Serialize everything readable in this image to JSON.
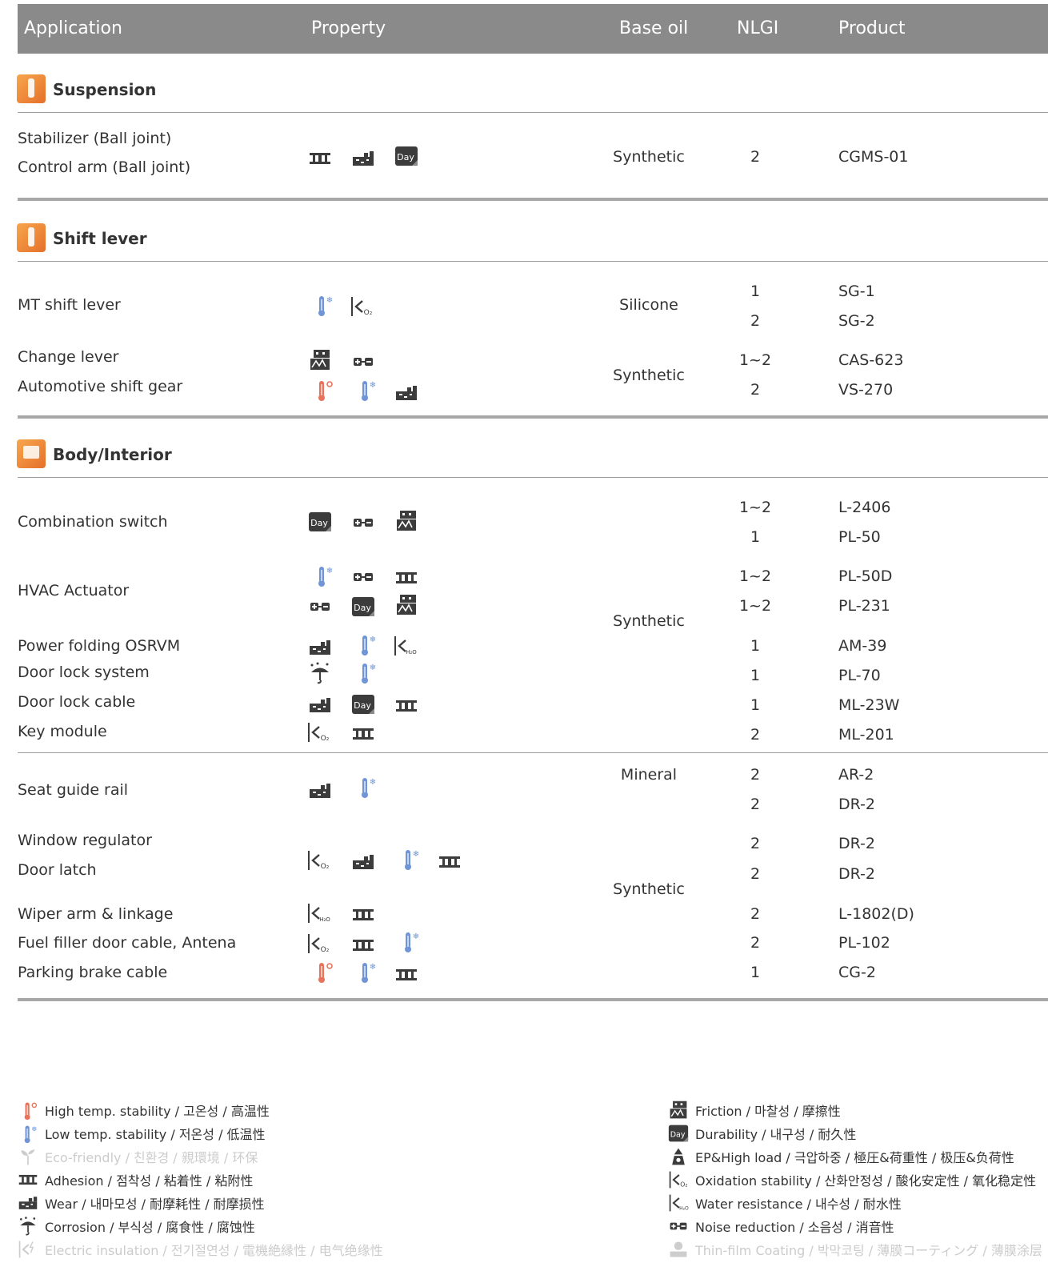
{
  "header": {
    "application": "Application",
    "property": "Property",
    "base_oil": "Base oil",
    "nlgi": "NLGI",
    "product": "Product"
  },
  "sections": {
    "suspension": {
      "title": "Suspension",
      "apps": [
        "Stabilizer (Ball joint)",
        "Control arm (Ball joint)"
      ],
      "base_oil": "Synthetic",
      "nlgi": [
        "2"
      ],
      "products": [
        "CGMS-01"
      ]
    },
    "shift_lever": {
      "title": "Shift lever",
      "apps": [
        "MT shift lever",
        "Change lever",
        "Automotive shift gear"
      ],
      "base_oil": [
        "Silicone",
        "Synthetic"
      ],
      "nlgi": [
        "1",
        "2",
        "1~2",
        "2"
      ],
      "products": [
        "SG-1",
        "SG-2",
        "CAS-623",
        "VS-270"
      ]
    },
    "body_interior": {
      "title": "Body/Interior",
      "apps": [
        "Combination switch",
        "HVAC Actuator",
        "Power folding OSRVM",
        "Door lock system",
        "Door lock cable",
        "Key module",
        "Seat guide rail",
        "Window regulator",
        "Door latch",
        "Wiper arm & linkage",
        "Fuel filler door cable, Antena",
        "Parking brake cable"
      ],
      "base_oil": [
        "Synthetic",
        "Mineral",
        "Synthetic"
      ],
      "nlgi": [
        "1~2",
        "1",
        "1~2",
        "1~2",
        "1",
        "1",
        "1",
        "2",
        "2",
        "2",
        "2",
        "2",
        "2",
        "2",
        "1"
      ],
      "products": [
        "L-2406",
        "PL-50",
        "PL-50D",
        "PL-231",
        "AM-39",
        "PL-70",
        "ML-23W",
        "ML-201",
        "AR-2",
        "DR-2",
        "DR-2",
        "DR-2",
        "L-1802(D)",
        "PL-102",
        "CG-2"
      ]
    }
  },
  "icon_labels": {
    "day": "Day",
    "o2": "O₂",
    "h2o": "H₂O"
  },
  "legend": {
    "left": [
      {
        "icon": "high-temp-icon",
        "text": "High temp. stability / 고온성 / 高温性",
        "active": true
      },
      {
        "icon": "low-temp-icon",
        "text": "Low temp. stability / 저온성 / 低温性",
        "active": true
      },
      {
        "icon": "eco-icon",
        "text": "Eco-friendly / 친환경 / 親環境 / 环保",
        "active": false
      },
      {
        "icon": "adhesion-icon",
        "text": "Adhesion / 점착성 / 粘着性 / 粘附性",
        "active": true
      },
      {
        "icon": "wear-icon",
        "text": "Wear / 내마모성 / 耐摩耗性 / 耐摩损性",
        "active": true
      },
      {
        "icon": "corrosion-icon",
        "text": "Corrosion / 부식성 / 腐食性 / 腐蚀性",
        "active": true
      },
      {
        "icon": "electric-insulation-icon",
        "text": "Electric insulation / 전기절연성 / 電機絶縁性 / 电气绝缘性",
        "active": false
      }
    ],
    "right": [
      {
        "icon": "friction-icon",
        "text": "Friction / 마찰성 / 摩擦性",
        "active": true
      },
      {
        "icon": "durability-icon",
        "text": "Durability / 내구성 / 耐久性",
        "active": true
      },
      {
        "icon": "ep-high-load-icon",
        "text": "EP&High load / 극압하중 / 極圧&荷重性  / 极压&负荷性",
        "active": true
      },
      {
        "icon": "oxidation-icon",
        "text": "Oxidation stability / 산화안정성 / 酸化安定性 / 氧化稳定性",
        "active": true
      },
      {
        "icon": "water-resistance-icon",
        "text": "Water resistance / 내수성 / 耐水性",
        "active": true
      },
      {
        "icon": "noise-reduction-icon",
        "text": "Noise reduction / 소음성 / 消音性",
        "active": true
      },
      {
        "icon": "thin-film-icon",
        "text": "Thin-film Coating / 박막코팅 / 薄膜コーティング / 薄膜涂层",
        "active": false
      }
    ]
  },
  "colors": {
    "header_bg": "#8a8a8a",
    "section_icon": "#ee8a3a",
    "high_temp": "#e8735a",
    "low_temp": "#6f95d6",
    "icon_dark": "#3c3c3c"
  }
}
